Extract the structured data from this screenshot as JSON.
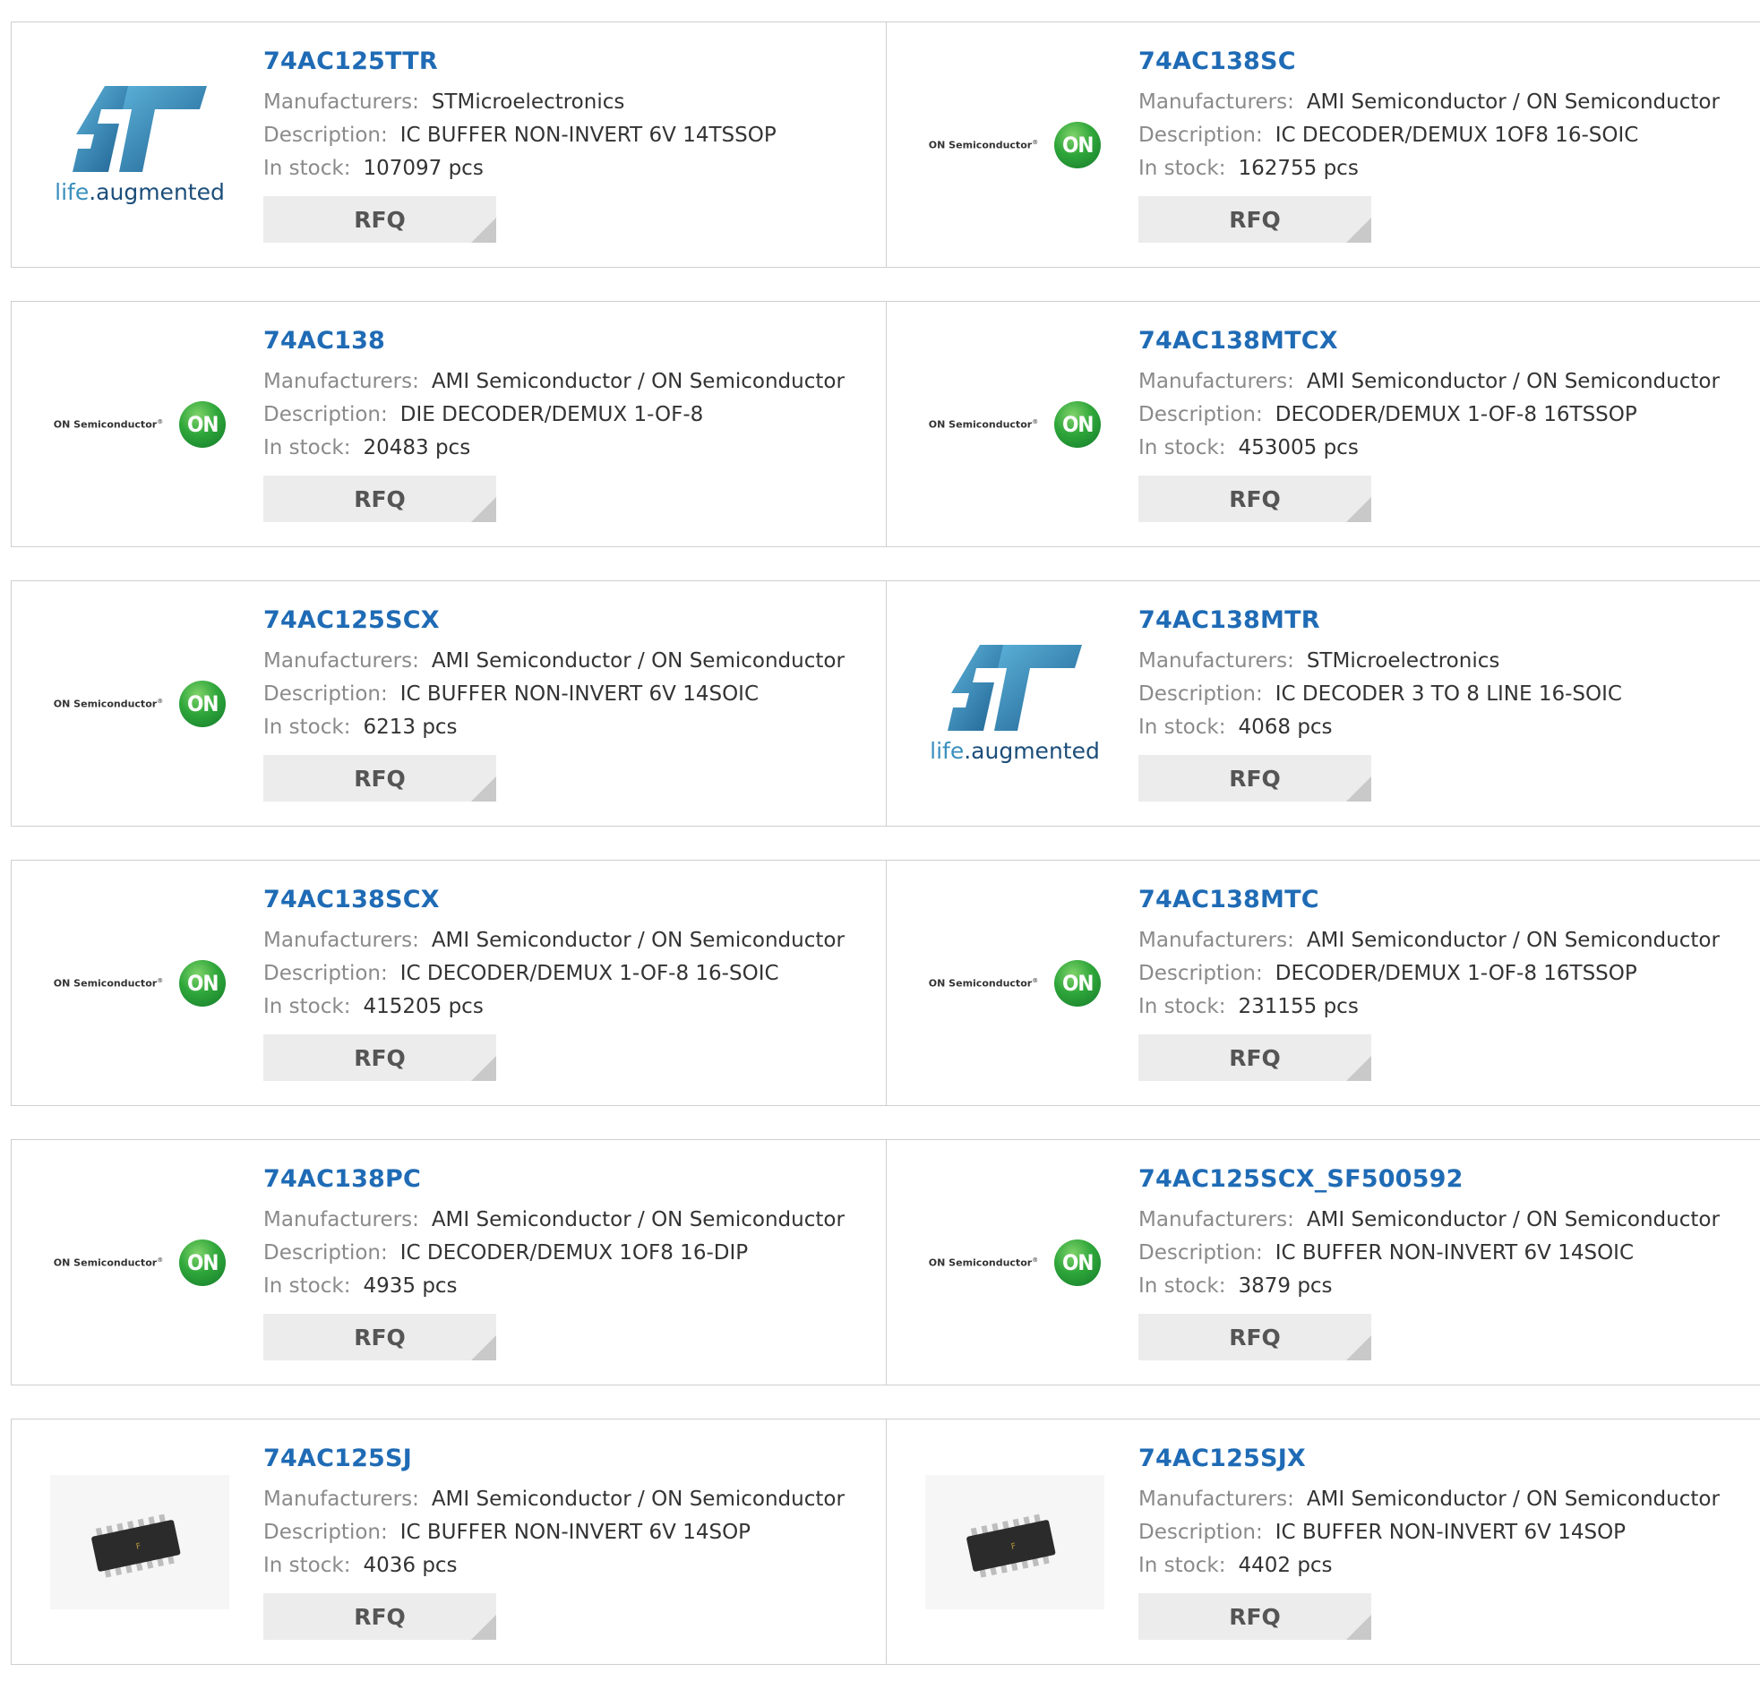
{
  "labels": {
    "manufacturers": "Manufacturers:",
    "description": "Description:",
    "in_stock": "In stock:",
    "rfq": "RFQ"
  },
  "logos": {
    "on": {
      "text": "ON Semiconductor",
      "mark": "®",
      "badge": "ON"
    },
    "st": {
      "tagline_a": "life",
      "tagline_dot": ".",
      "tagline_b": "augmented"
    }
  },
  "products": [
    {
      "pn": "74AC125TTR",
      "manufacturer": "STMicroelectronics",
      "description": "IC BUFFER NON-INVERT 6V 14TSSOP",
      "stock": "107097 pcs",
      "logo": "st-logo"
    },
    {
      "pn": "74AC138SC",
      "manufacturer": "AMI Semiconductor / ON Semiconductor",
      "description": "IC DECODER/DEMUX 1OF8 16-SOIC",
      "stock": "162755 pcs",
      "logo": "on-semiconductor-logo"
    },
    {
      "pn": "74AC138",
      "manufacturer": "AMI Semiconductor / ON Semiconductor",
      "description": "DIE DECODER/DEMUX 1-OF-8",
      "stock": "20483 pcs",
      "logo": "on-semiconductor-logo"
    },
    {
      "pn": "74AC138MTCX",
      "manufacturer": "AMI Semiconductor / ON Semiconductor",
      "description": "DECODER/DEMUX 1-OF-8 16TSSOP",
      "stock": "453005 pcs",
      "logo": "on-semiconductor-logo"
    },
    {
      "pn": "74AC125SCX",
      "manufacturer": "AMI Semiconductor / ON Semiconductor",
      "description": "IC BUFFER NON-INVERT 6V 14SOIC",
      "stock": "6213 pcs",
      "logo": "on-semiconductor-logo"
    },
    {
      "pn": "74AC138MTR",
      "manufacturer": "STMicroelectronics",
      "description": "IC DECODER 3 TO 8 LINE 16-SOIC",
      "stock": "4068 pcs",
      "logo": "st-logo"
    },
    {
      "pn": "74AC138SCX",
      "manufacturer": "AMI Semiconductor / ON Semiconductor",
      "description": "IC DECODER/DEMUX 1-OF-8 16-SOIC",
      "stock": "415205 pcs",
      "logo": "on-semiconductor-logo"
    },
    {
      "pn": "74AC138MTC",
      "manufacturer": "AMI Semiconductor / ON Semiconductor",
      "description": "DECODER/DEMUX 1-OF-8 16TSSOP",
      "stock": "231155 pcs",
      "logo": "on-semiconductor-logo"
    },
    {
      "pn": "74AC138PC",
      "manufacturer": "AMI Semiconductor / ON Semiconductor",
      "description": "IC DECODER/DEMUX 1OF8 16-DIP",
      "stock": "4935 pcs",
      "logo": "on-semiconductor-logo"
    },
    {
      "pn": "74AC125SCX_SF500592",
      "manufacturer": "AMI Semiconductor / ON Semiconductor",
      "description": "IC BUFFER NON-INVERT 6V 14SOIC",
      "stock": "3879 pcs",
      "logo": "on-semiconductor-logo"
    },
    {
      "pn": "74AC125SJ",
      "manufacturer": "AMI Semiconductor / ON Semiconductor",
      "description": "IC BUFFER NON-INVERT 6V 14SOP",
      "stock": "4036 pcs",
      "logo": "chip-photo"
    },
    {
      "pn": "74AC125SJX",
      "manufacturer": "AMI Semiconductor / ON Semiconductor",
      "description": "IC BUFFER NON-INVERT 6V 14SOP",
      "stock": "4402 pcs",
      "logo": "chip-photo"
    }
  ],
  "colors": {
    "link": "#1f6bb5",
    "label": "#8a8a8a",
    "rfq_bg": "#ececec",
    "border": "#cfcfcf"
  }
}
